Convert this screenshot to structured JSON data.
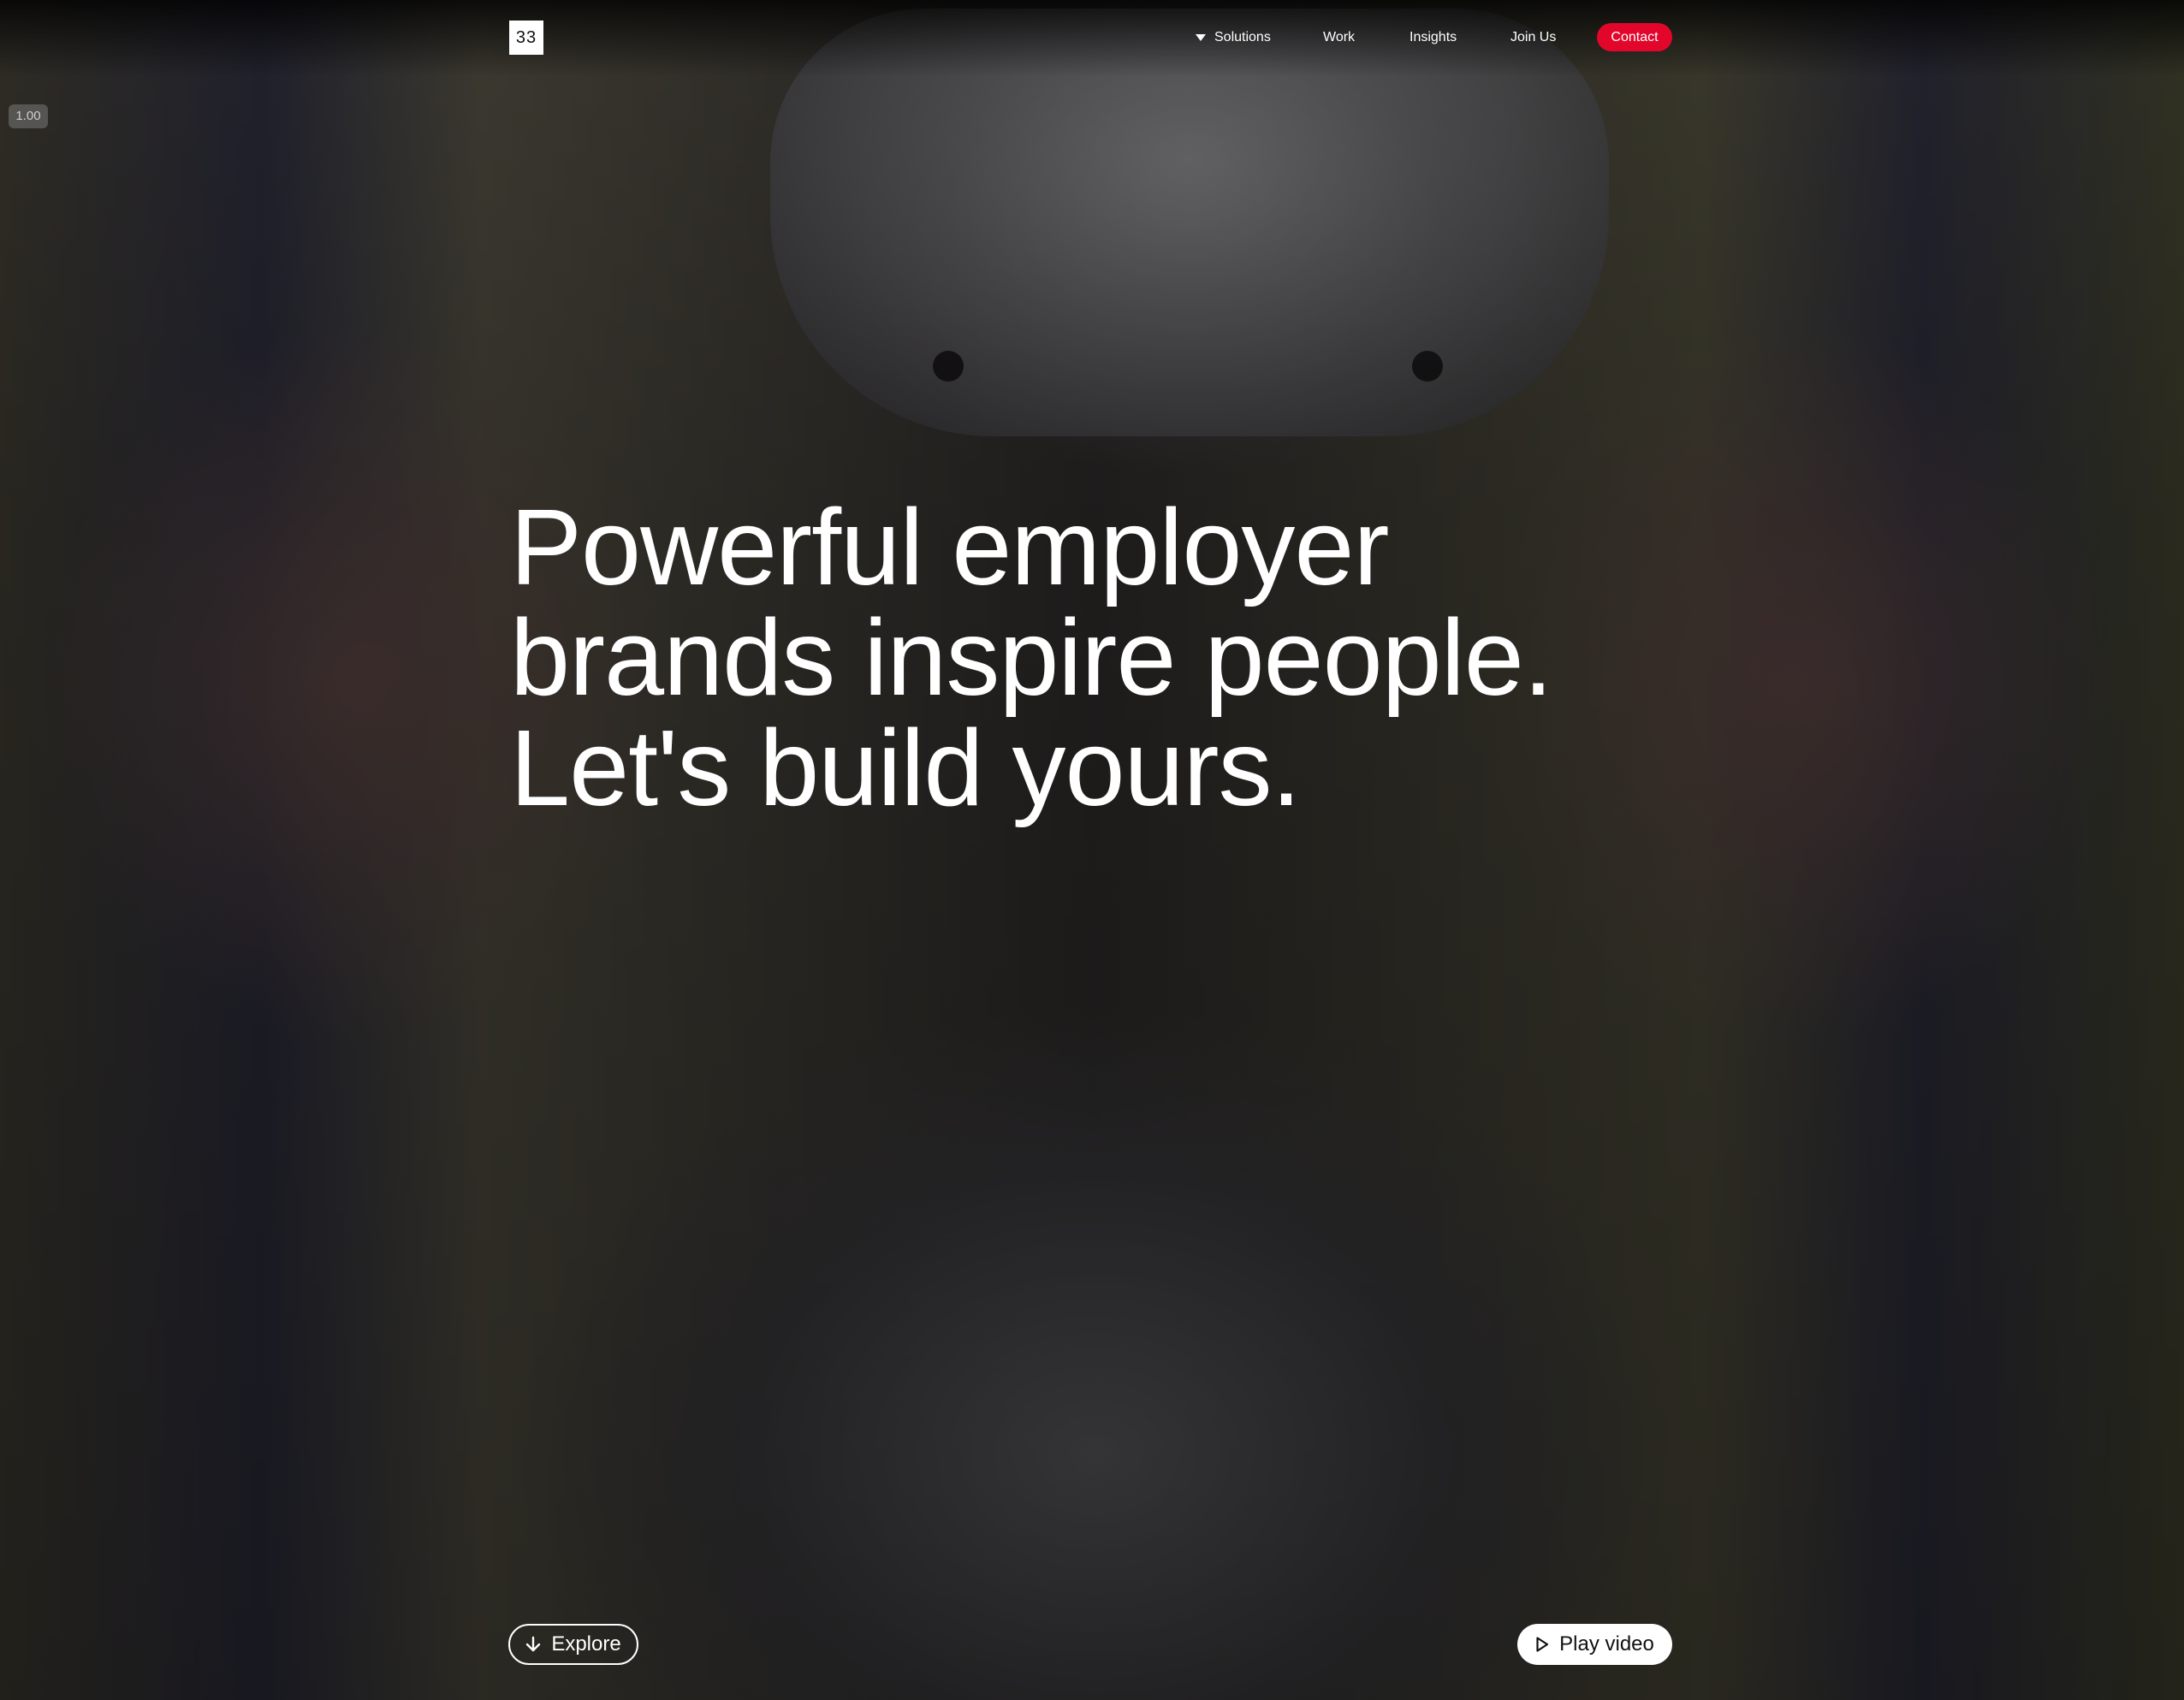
{
  "zoom_badge": "1.00",
  "header": {
    "logo_text": "33",
    "nav": {
      "solutions": "Solutions",
      "work": "Work",
      "insights": "Insights",
      "join_us": "Join Us"
    },
    "contact_label": "Contact"
  },
  "hero": {
    "headline_lines": [
      "Powerful employer",
      "brands inspire people.",
      "Let's build yours."
    ],
    "explore_label": "Explore",
    "play_video_label": "Play video"
  },
  "icons": {
    "solutions_dropdown": "caret-down-icon",
    "explore": "arrow-down-icon",
    "play": "play-icon"
  },
  "colors": {
    "accent": "#e3062b",
    "text": "#ffffff",
    "button_bg": "#ffffff"
  }
}
